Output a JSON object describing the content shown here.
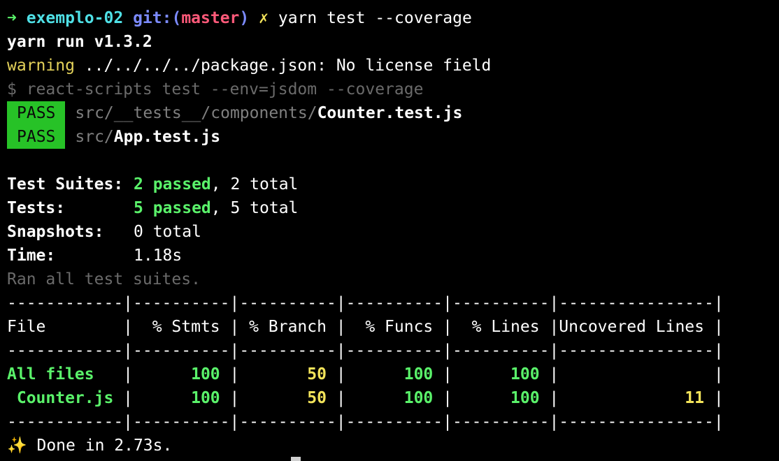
{
  "prompt": {
    "arrow": "➜",
    "dir": "exemplo-02",
    "git_label": "git:(",
    "branch": "master",
    "git_close": ")",
    "dirty": "✗",
    "command": "yarn test --coverage"
  },
  "yarn_version": "yarn run v1.3.2",
  "warning": {
    "label": "warning",
    "text": "../../../../package.json: No license field"
  },
  "script_cmd": "$ react-scripts test --env=jsdom --coverage",
  "tests": [
    {
      "status": "PASS",
      "path": "src/__tests__/components/",
      "file": "Counter.test.js"
    },
    {
      "status": "PASS",
      "path": "src/",
      "file": "App.test.js"
    }
  ],
  "summary": {
    "suites_label": "Test Suites:",
    "suites_passed": "2 passed",
    "suites_total": ", 2 total",
    "tests_label": "Tests:",
    "tests_passed": "5 passed",
    "tests_total": ", 5 total",
    "snapshots_label": "Snapshots:",
    "snapshots_value": "0 total",
    "time_label": "Time:",
    "time_value": "1.18s",
    "ran_all": "Ran all test suites."
  },
  "coverage": {
    "separator": "------------|----------|----------|----------|----------|----------------|",
    "header": "File        |  % Stmts | % Branch |  % Funcs |  % Lines |Uncovered Lines |",
    "rows": [
      {
        "file": "All files   ",
        "stmts": "100",
        "branch": "50",
        "funcs": "100",
        "lines": "100",
        "uncovered": ""
      },
      {
        "file": " Counter.js ",
        "stmts": "100",
        "branch": "50",
        "funcs": "100",
        "lines": "100",
        "uncovered": "11"
      }
    ]
  },
  "done": {
    "icon": "✨",
    "text": " Done in 2.73s."
  }
}
